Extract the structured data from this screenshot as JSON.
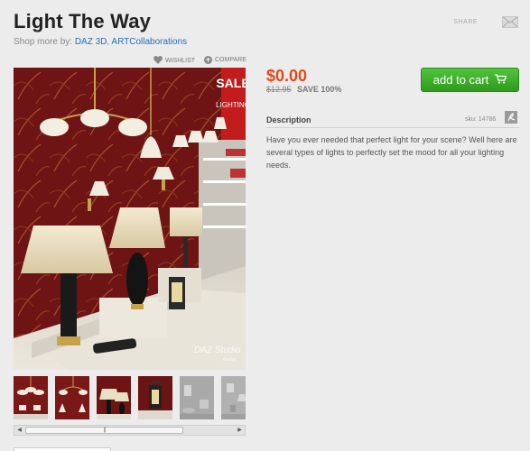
{
  "product": {
    "title": "Light The Way",
    "shop_more_label": "Shop more by:",
    "vendors": [
      "DAZ 3D",
      "ARTCollaborations"
    ]
  },
  "actions": {
    "share_label": "SHARE",
    "wishlist_label": "WISHLIST",
    "compare_label": "COMPARE",
    "add_to_cart_label": "add to cart"
  },
  "pricing": {
    "price": "$0.00",
    "original_price": "$12.95",
    "savings": "SAVE 100%"
  },
  "description": {
    "heading": "Description",
    "sku": "sku: 14786",
    "text": "Have you ever needed that perfect light for your scene? Well here are several types of lights to perfectly set the mood for all your lighting needs."
  },
  "image": {
    "sign_text": "SALE",
    "sign_text2": "LIGHTING",
    "watermark": "DAZ Studio",
    "watermark_sub": "render"
  },
  "gallery": {
    "thumbnail_count": 6
  },
  "colors": {
    "price": "#e0491a",
    "cart_button": "#3caf28",
    "link": "#2a6fb5",
    "wallpaper": "#6a1212"
  }
}
